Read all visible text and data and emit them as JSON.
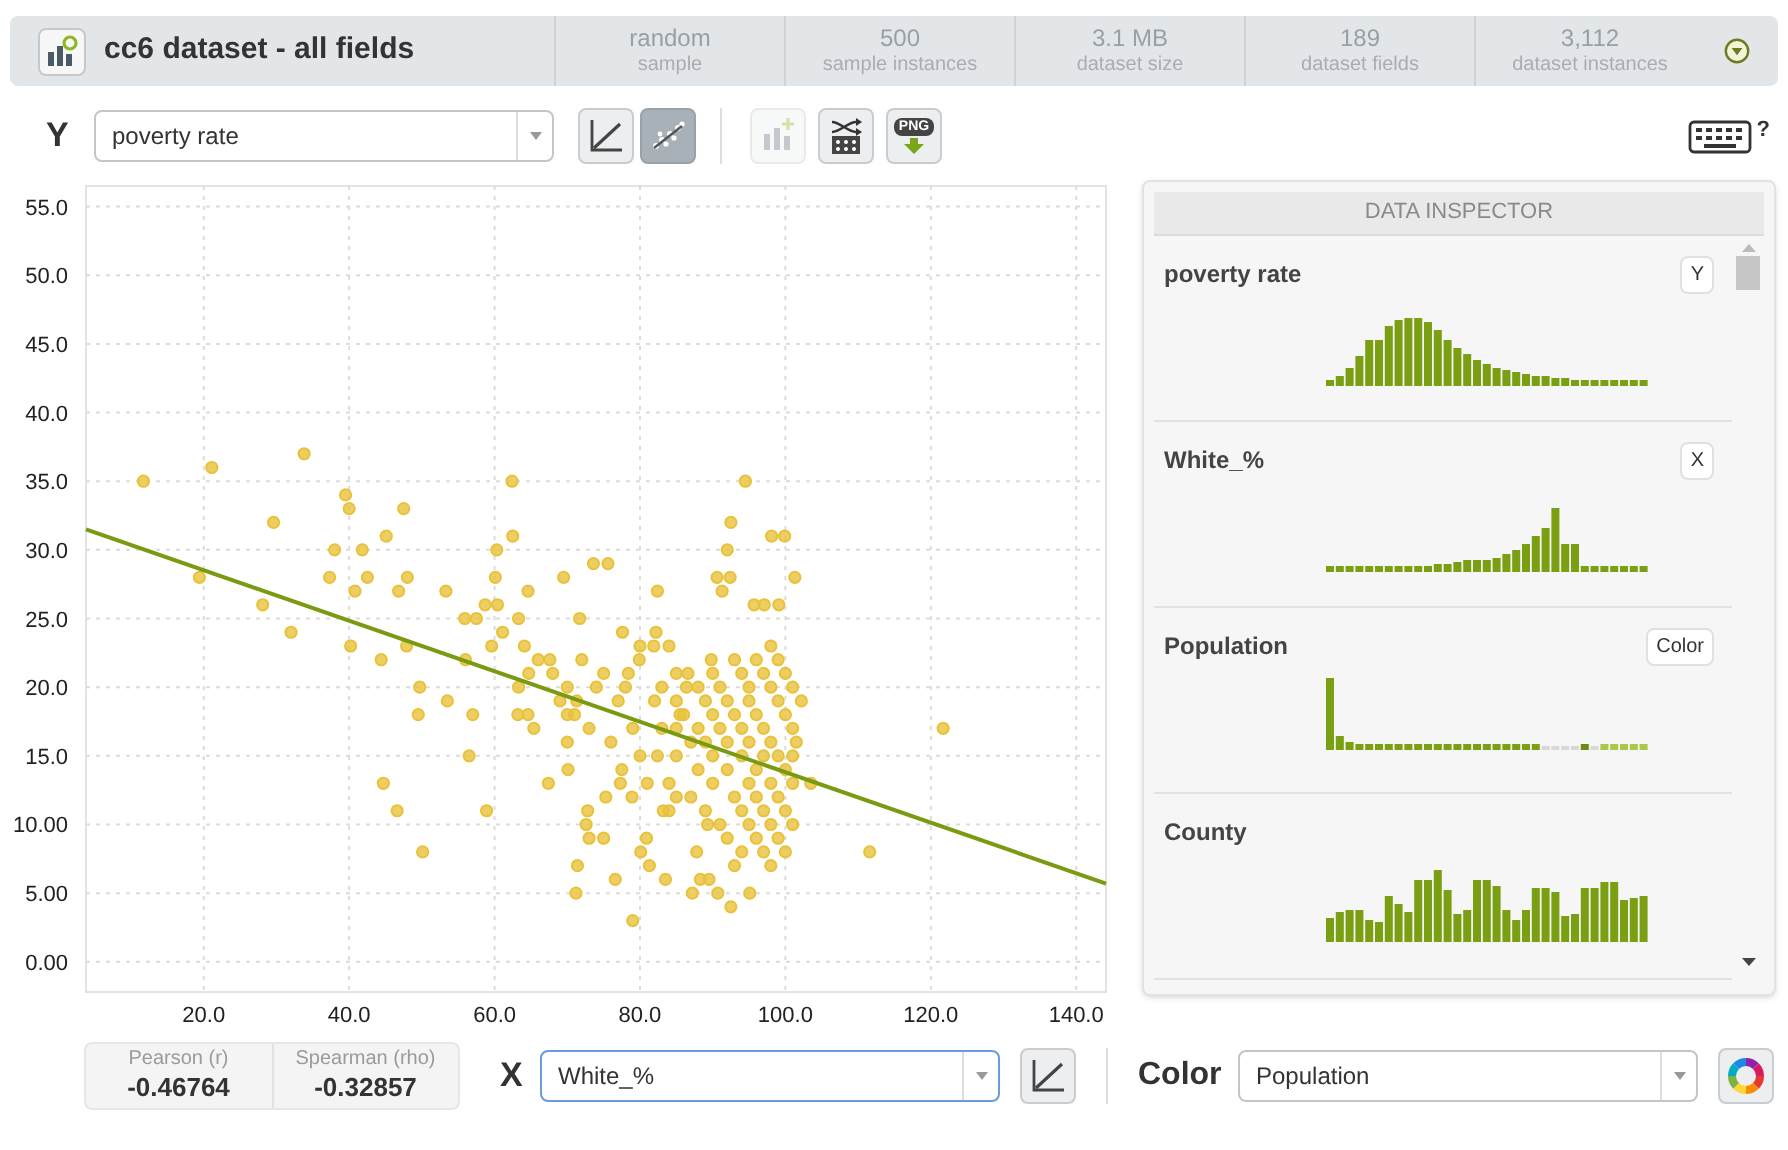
{
  "header": {
    "title": "cc6 dataset - all fields",
    "stats": [
      {
        "value": "random",
        "label": "sample"
      },
      {
        "value": "500",
        "label": "sample instances"
      },
      {
        "value": "3.1 MB",
        "label": "dataset size"
      },
      {
        "value": "189",
        "label": "dataset fields"
      },
      {
        "value": "3,112",
        "label": "dataset instances"
      }
    ]
  },
  "y_axis": {
    "label": "Y",
    "field": "poverty rate",
    "buttons": [
      {
        "kind": "trend",
        "selected": false
      },
      {
        "kind": "scatter",
        "selected": true
      }
    ]
  },
  "tools": [
    {
      "kind": "add_chart",
      "disabled": true
    },
    {
      "kind": "shuffle",
      "disabled": false
    },
    {
      "kind": "png",
      "label": "PNG",
      "disabled": false
    }
  ],
  "keyboard_help": {
    "label": "?"
  },
  "chart": {
    "chart_data": {
      "type": "scatter",
      "grid": true,
      "xlim": [
        3.8,
        144.1
      ],
      "ylim": [
        -2.2,
        56.5
      ],
      "xticks": [
        {
          "value": 20,
          "label": "20.0"
        },
        {
          "value": 40,
          "label": "40.0"
        },
        {
          "value": 60,
          "label": "60.0"
        },
        {
          "value": 80,
          "label": "80.0"
        },
        {
          "value": 100,
          "label": "100.0"
        },
        {
          "value": 120,
          "label": "120.0"
        },
        {
          "value": 140,
          "label": "140.0"
        }
      ],
      "yticks": [
        {
          "value": 55,
          "label": "55.0"
        },
        {
          "value": 50,
          "label": "50.0"
        },
        {
          "value": 45,
          "label": "45.0"
        },
        {
          "value": 40,
          "label": "40.0"
        },
        {
          "value": 35,
          "label": "35.0"
        },
        {
          "value": 30,
          "label": "30.0"
        },
        {
          "value": 25,
          "label": "25.0"
        },
        {
          "value": 20,
          "label": "20.0"
        },
        {
          "value": 15,
          "label": "15.0"
        },
        {
          "value": 10,
          "label": "10.00"
        },
        {
          "value": 5,
          "label": "5.00"
        },
        {
          "value": 0,
          "label": "0.00"
        }
      ],
      "x": [
        11.7,
        21.1,
        19.4,
        29.6,
        28.1,
        32,
        33.8,
        39.5,
        40,
        38,
        37.3,
        41.8,
        42.5,
        40.8,
        45.1,
        47.5,
        46.8,
        48,
        44.4,
        40.2,
        47.9,
        49.7,
        49.5,
        44.7,
        46.6,
        50.1,
        53.5,
        53.3,
        56.5,
        56,
        57,
        55.9,
        57.5,
        58.7,
        60.4,
        60.1,
        60.3,
        62.4,
        62.5,
        58.9,
        59.6,
        61.1,
        63.3,
        64.6,
        63.3,
        64.7,
        64.1,
        63.2,
        64.6,
        65.4,
        67.4,
        69.5,
        67.6,
        70,
        71.7,
        73.6,
        75.6,
        71.3,
        70,
        70.1,
        71.4,
        71.2,
        72.8,
        73,
        75,
        72.6,
        75.3,
        76.6,
        79,
        77.6,
        78.4,
        79.9,
        77.5,
        77.3,
        78.9,
        80.1,
        81.3,
        83.5,
        80.9,
        82.4,
        82.2,
        81.9,
        82.4,
        83.2,
        84,
        85.5,
        86.4,
        86.6,
        87.2,
        87.8,
        88.3,
        89.5,
        89.3,
        89.8,
        90.6,
        91.3,
        92,
        92.5,
        92.4,
        94.5,
        90.7,
        92.5,
        95.1,
        95.7,
        97.1,
        99.1,
        98.1,
        99.9,
        101.3,
        102.2,
        101.5,
        103.5,
        111.6,
        121.7,
        85,
        85,
        85,
        85,
        85,
        86,
        87,
        87,
        88,
        88,
        88,
        89,
        89,
        89,
        90,
        90,
        90,
        90,
        91,
        91,
        91,
        92,
        92,
        92,
        92,
        93,
        93,
        93,
        93,
        94,
        94,
        94,
        94,
        94,
        95,
        95,
        95,
        95,
        95,
        96,
        96,
        96,
        96,
        96,
        97,
        97,
        97,
        97,
        97,
        98,
        98,
        98,
        98,
        98,
        98,
        99,
        99,
        99,
        99,
        99,
        100,
        100,
        100,
        100,
        100,
        101,
        101,
        101,
        101,
        101,
        75,
        77,
        79,
        80,
        81,
        83,
        83,
        84,
        76,
        78,
        82,
        84,
        80,
        74,
        72,
        70,
        68,
        66,
        73,
        71,
        69,
        3.8,
        144.1
      ],
      "series": [
        {
          "color": "#e9c23c",
          "values": [
            35,
            36,
            28,
            32,
            26,
            24,
            37,
            34,
            33,
            30,
            28,
            30,
            28,
            27,
            31,
            33,
            27,
            28,
            22,
            23,
            23,
            20,
            18,
            13,
            11,
            8,
            19,
            27,
            15,
            22,
            18,
            25,
            25,
            26,
            26,
            28,
            30,
            35,
            31,
            11,
            23,
            24,
            25,
            27,
            20,
            21,
            23,
            18,
            18,
            17,
            13,
            28,
            22,
            18,
            25,
            29,
            29,
            19,
            16,
            14,
            7,
            5,
            11,
            9,
            9,
            10,
            12,
            6,
            3,
            24,
            21,
            22,
            14,
            13,
            12,
            8,
            7,
            6,
            9,
            27,
            24,
            23,
            15,
            11,
            13,
            18,
            20,
            21,
            5,
            8,
            6,
            6,
            10,
            22,
            28,
            27,
            30,
            32,
            28,
            35,
            5,
            4,
            5,
            26,
            26,
            26,
            31,
            31,
            28,
            19,
            16,
            13,
            8,
            17,
            21,
            19,
            17,
            15,
            12,
            18,
            16,
            12,
            20,
            17,
            14,
            19,
            16,
            11,
            21,
            18,
            15,
            13,
            20,
            17,
            10,
            19,
            16,
            14,
            9,
            22,
            18,
            12,
            7,
            21,
            17,
            15,
            11,
            8,
            20,
            19,
            16,
            13,
            10,
            22,
            18,
            14,
            12,
            9,
            21,
            17,
            15,
            11,
            8,
            23,
            20,
            16,
            13,
            10,
            7,
            22,
            19,
            15,
            12,
            9,
            21,
            18,
            14,
            11,
            8,
            20,
            17,
            13,
            10,
            15,
            21,
            19,
            17,
            15,
            13,
            17,
            20,
            11,
            16,
            20,
            19,
            23,
            23,
            20,
            22,
            20,
            21,
            22,
            17,
            18,
            19,
            null,
            null
          ]
        },
        {
          "type": "line",
          "color": "#7a9a12",
          "values": [
            null,
            null,
            null,
            null,
            null,
            null,
            null,
            null,
            null,
            null,
            null,
            null,
            null,
            null,
            null,
            null,
            null,
            null,
            null,
            null,
            null,
            null,
            null,
            null,
            null,
            null,
            null,
            null,
            null,
            null,
            null,
            null,
            null,
            null,
            null,
            null,
            null,
            null,
            null,
            null,
            null,
            null,
            null,
            null,
            null,
            null,
            null,
            null,
            null,
            null,
            null,
            null,
            null,
            null,
            null,
            null,
            null,
            null,
            null,
            null,
            null,
            null,
            null,
            null,
            null,
            null,
            null,
            null,
            null,
            null,
            null,
            null,
            null,
            null,
            null,
            null,
            null,
            null,
            null,
            null,
            null,
            null,
            null,
            null,
            null,
            null,
            null,
            null,
            null,
            null,
            null,
            null,
            null,
            null,
            null,
            null,
            null,
            null,
            null,
            null,
            null,
            null,
            null,
            null,
            null,
            null,
            null,
            null,
            null,
            null,
            null,
            null,
            null,
            null,
            null,
            null,
            null,
            null,
            null,
            null,
            null,
            null,
            null,
            null,
            null,
            null,
            null,
            null,
            null,
            null,
            null,
            null,
            null,
            null,
            null,
            null,
            null,
            null,
            null,
            null,
            null,
            null,
            null,
            null,
            null,
            null,
            null,
            null,
            null,
            null,
            null,
            null,
            null,
            null,
            null,
            null,
            null,
            null,
            null,
            null,
            null,
            null,
            null,
            null,
            null,
            null,
            null,
            null,
            null,
            null,
            null,
            null,
            null,
            null,
            null,
            null,
            null,
            null,
            null,
            null,
            null,
            null,
            null,
            null,
            null,
            null,
            null,
            null,
            null,
            null,
            null,
            null,
            null,
            null,
            null,
            null,
            null,
            null,
            null,
            null,
            null,
            null,
            null,
            null,
            null,
            31.5,
            5.7
          ]
        }
      ]
    }
  },
  "inspector": {
    "title": "DATA INSPECTOR",
    "fields": [
      {
        "name": "poverty rate",
        "badge": "Y"
      },
      {
        "name": "White_%",
        "badge": "X"
      },
      {
        "name": "Population",
        "badge": "Color"
      },
      {
        "name": "County"
      }
    ]
  },
  "correlation": [
    {
      "label": "Pearson (r)",
      "value": "-0.46764"
    },
    {
      "label": "Spearman (rho)",
      "value": "-0.32857"
    }
  ],
  "x_axis": {
    "label": "X",
    "field": "White_%",
    "focused": true,
    "buttons": [
      {
        "kind": "trend",
        "selected": false
      }
    ]
  },
  "color_axis": {
    "label": "Color",
    "field": "Population",
    "focused": false
  }
}
